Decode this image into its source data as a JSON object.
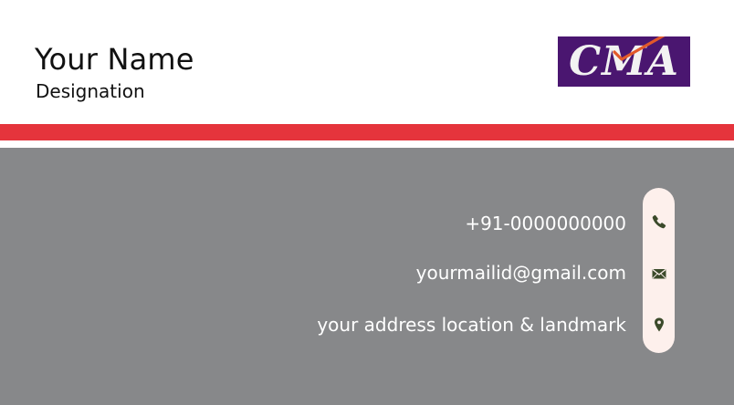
{
  "card": {
    "name": "Your Name",
    "designation": "Designation",
    "logo_text": "CMA",
    "contacts": [
      {
        "text": "+91-0000000000",
        "icon": "phone-icon"
      },
      {
        "text": "yourmailid@gmail.com",
        "icon": "mail-icon"
      },
      {
        "text": "your address location & landmark",
        "icon": "location-pin-icon"
      }
    ]
  },
  "colors": {
    "accent_red": "#e5343c",
    "grey_panel": "#87888a",
    "logo_purple": "#4a1670",
    "logo_check": "#e2592a",
    "icon_green": "#3b4a2a",
    "pill_bg": "#fdf0ec"
  }
}
